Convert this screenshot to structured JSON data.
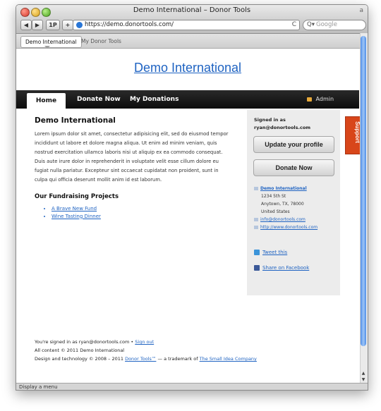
{
  "browser": {
    "window_title": "Demo International – Donor Tools",
    "resize_hint": "a",
    "back_glyph": "◀",
    "forward_glyph": "▶",
    "onepassword_label": "1P",
    "new_tab_label": "+",
    "url": "https://demo.donortools.com/",
    "reload_glyph": "C",
    "search_icon_glyph": "Q▾",
    "search_placeholder": "Google",
    "tabs": [
      {
        "label": "Demo International"
      },
      {
        "label": "My Donor Tools"
      }
    ],
    "status_text": "Display a menu",
    "scroll_up_glyph": "▲",
    "scroll_down_glyph": "▼"
  },
  "site": {
    "title": "Demo International",
    "nav": [
      {
        "label": "Home"
      },
      {
        "label": "Donate Now"
      },
      {
        "label": "My Donations"
      }
    ],
    "admin_label": "Admin"
  },
  "main": {
    "heading": "Demo International",
    "body": "Lorem ipsum dolor sit amet, consectetur adipisicing elit, sed do eiusmod tempor incididunt ut labore et dolore magna aliqua. Ut enim ad minim veniam, quis nostrud exercitation ullamco laboris nisi ut aliquip ex ea commodo consequat. Duis aute irure dolor in reprehenderit in voluptate velit esse cillum dolore eu fugiat nulla pariatur. Excepteur sint occaecat cupidatat non proident, sunt in culpa qui officia deserunt mollit anim id est laborum.",
    "projects_heading": "Our Fundraising Projects",
    "projects": [
      "A Brave New Fund",
      "Wine Tasting Dinner"
    ]
  },
  "sidebar": {
    "signed_in_label": "Signed in as",
    "signed_in_email": "ryan@donortools.com",
    "update_profile_button": "Update your profile",
    "donate_button": "Donate Now",
    "org_name": "Demo International",
    "address_line1": "1234 5th St",
    "address_line2": "Anytown, TX, 78000",
    "address_line3": "United States",
    "email": "info@donortools.com",
    "website": "http://www.donortools.com",
    "tweet_label": "Tweet this",
    "facebook_label": "Share on Facebook"
  },
  "footer": {
    "signed_in_text": "You're signed in as ryan@donortools.com •",
    "sign_out_label": "Sign out",
    "copyright": "All content © 2011 Demo International",
    "design_prefix": "Design and technology © 2008 – 2011",
    "donor_tools_link": "Donor Tools™",
    "trademark_text": "— a trademark of",
    "company_link": "The Small Idea Company"
  },
  "support_tab": "Support",
  "colors": {
    "link": "#1f63c2",
    "navbar": "#111111",
    "support": "#d8461a"
  }
}
